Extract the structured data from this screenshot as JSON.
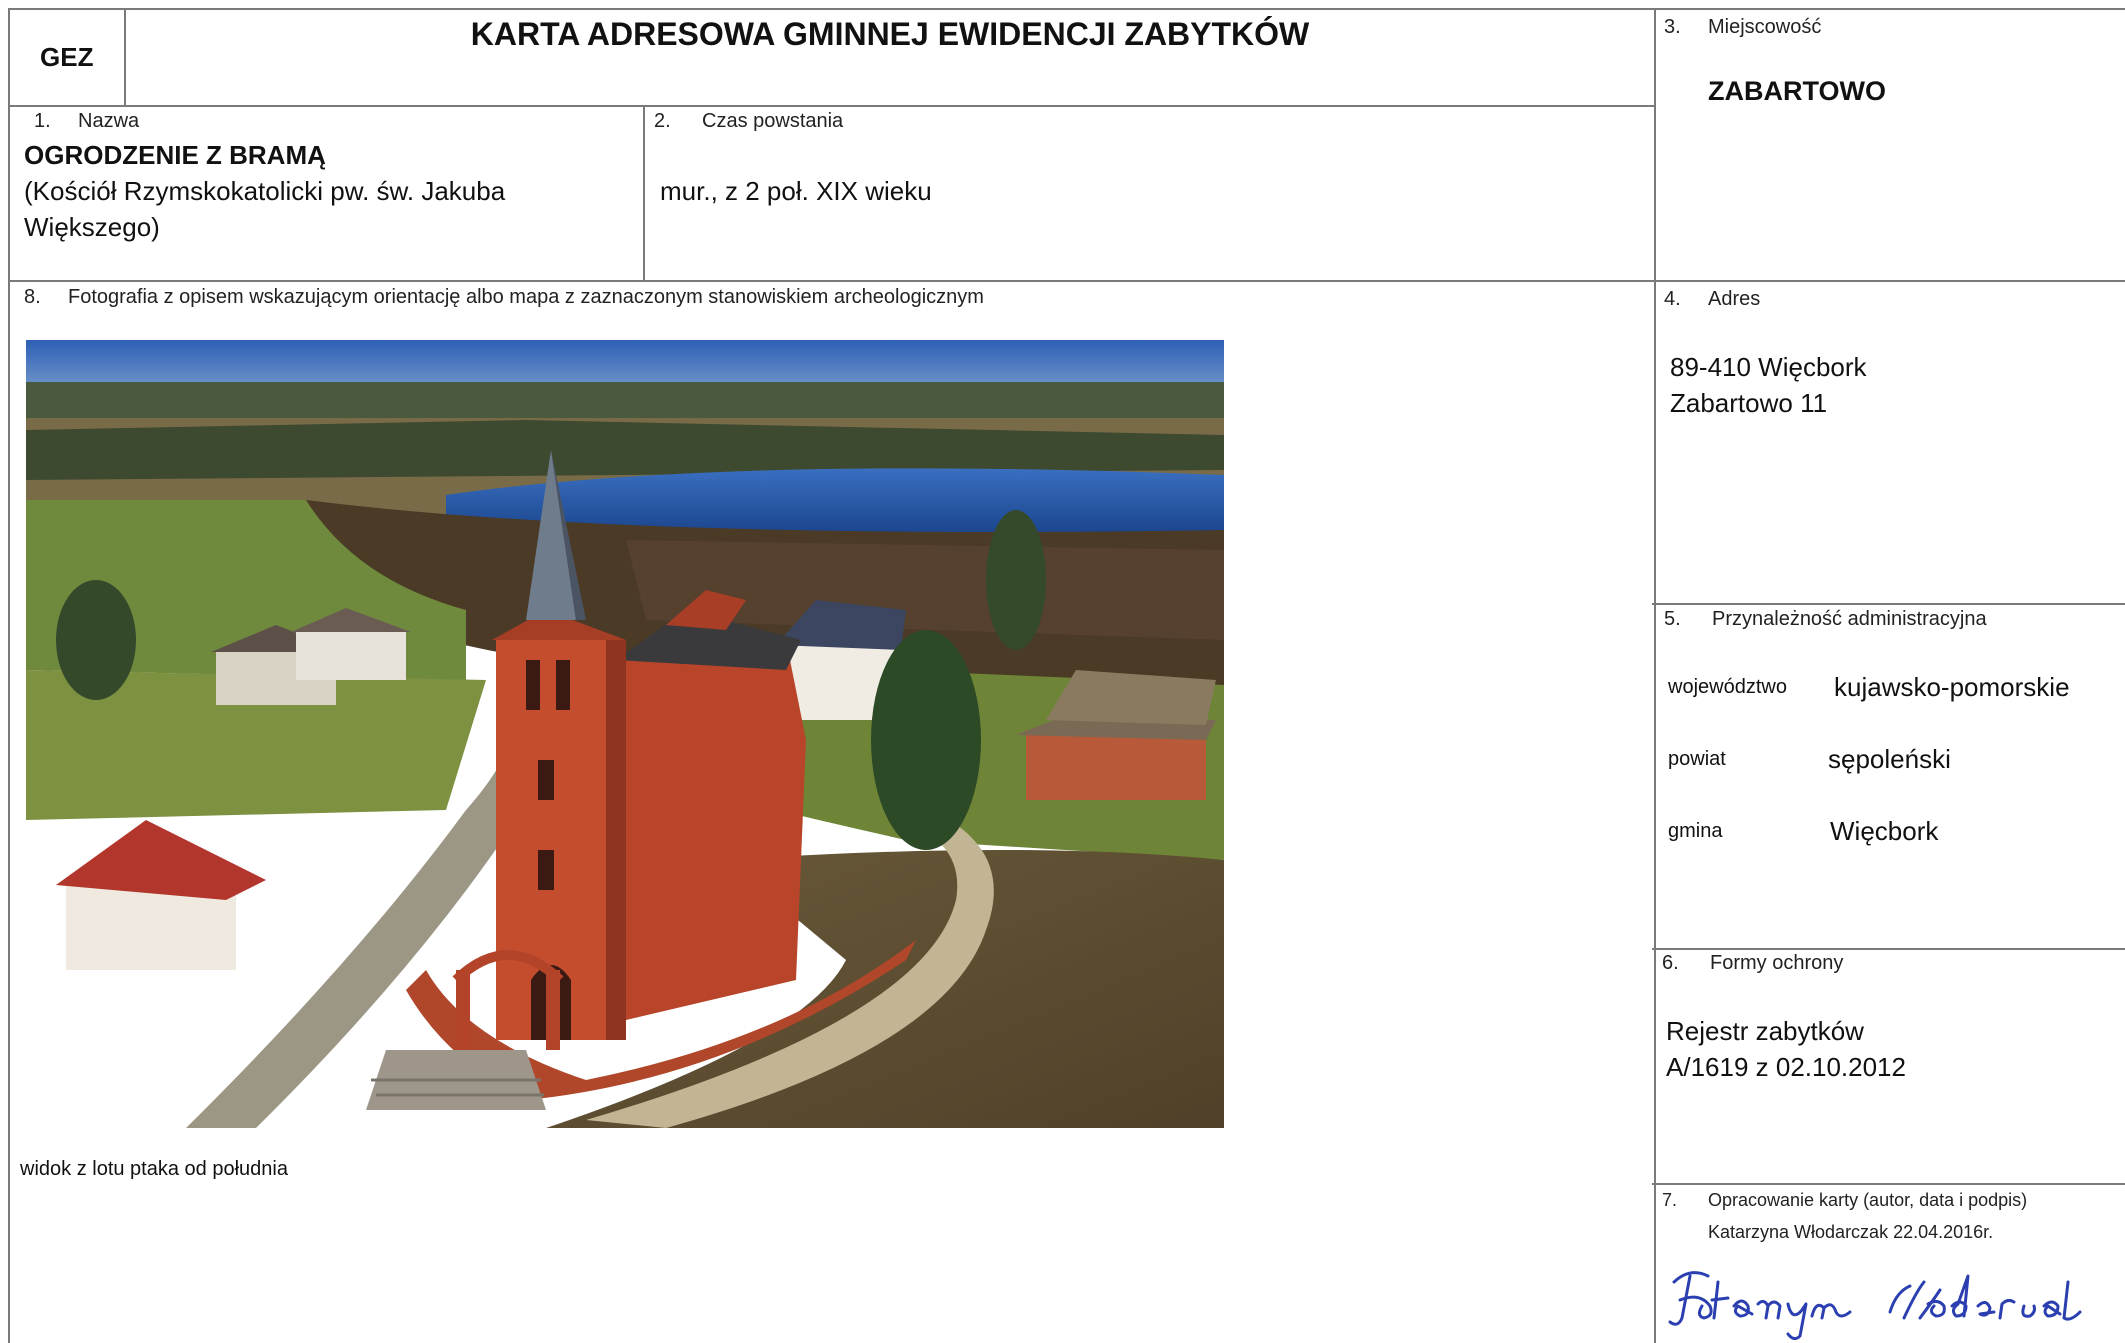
{
  "header": {
    "code": "GEZ",
    "title": "KARTA ADRESOWA GMINNEJ EWIDENCJI ZABYTKÓW"
  },
  "field1": {
    "number": "1.",
    "label": "Nazwa",
    "name": "OGRODZENIE Z BRAMĄ",
    "sub_line1": "(Kościół Rzymskokatolicki pw. św. Jakuba",
    "sub_line2": "Większego)"
  },
  "field2": {
    "number": "2.",
    "label": "Czas powstania",
    "value": "mur., z 2 poł. XIX wieku"
  },
  "field3": {
    "number": "3.",
    "label": "Miejscowość",
    "value": "ZABARTOWO"
  },
  "field4": {
    "number": "4.",
    "label": "Adres",
    "line1": "89-410 Więcbork",
    "line2": "Zabartowo 11"
  },
  "field5": {
    "number": "5.",
    "label": "Przynależność administracyjna",
    "rows": [
      {
        "key": "województwo",
        "value": "kujawsko-pomorskie"
      },
      {
        "key": "powiat",
        "value": "sępoleński"
      },
      {
        "key": "gmina",
        "value": "Więcbork"
      }
    ]
  },
  "field6": {
    "number": "6.",
    "label": "Formy ochrony",
    "line1": "Rejestr zabytków",
    "line2": "A/1619 z 02.10.2012"
  },
  "field7": {
    "number": "7.",
    "label": "Opracowanie karty (autor, data i podpis)",
    "author": "Katarzyna Włodarczak 22.04.2016r."
  },
  "field8": {
    "number": "8.",
    "label": "Fotografia z opisem wskazującym orientację albo mapa z zaznaczonym stanowiskiem archeologicznym",
    "caption": "widok z lotu ptaka od południa"
  },
  "colors": {
    "grid_line": "#7a7a7a",
    "signature_ink": "#2b3fb0",
    "brick": "#b8452a",
    "lake": "#1d4f9e",
    "sky": "#2d5fb5"
  }
}
